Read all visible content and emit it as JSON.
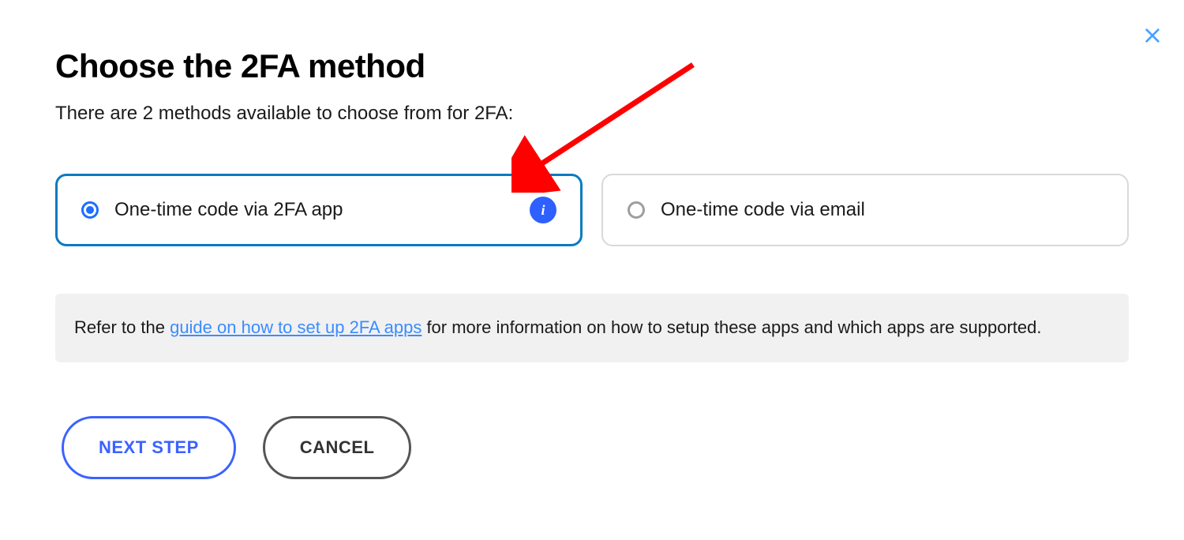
{
  "header": {
    "title": "Choose the 2FA method",
    "subtitle": "There are 2 methods available to choose from for 2FA:"
  },
  "options": {
    "app": {
      "label": "One-time code via 2FA app",
      "info_icon": "i"
    },
    "email": {
      "label": "One-time code via email"
    }
  },
  "info": {
    "prefix": "Refer to the ",
    "link_text": "guide on how to set up 2FA apps",
    "suffix": " for more information on how to setup these apps and which apps are supported."
  },
  "buttons": {
    "next": "Next Step",
    "cancel": "Cancel"
  }
}
